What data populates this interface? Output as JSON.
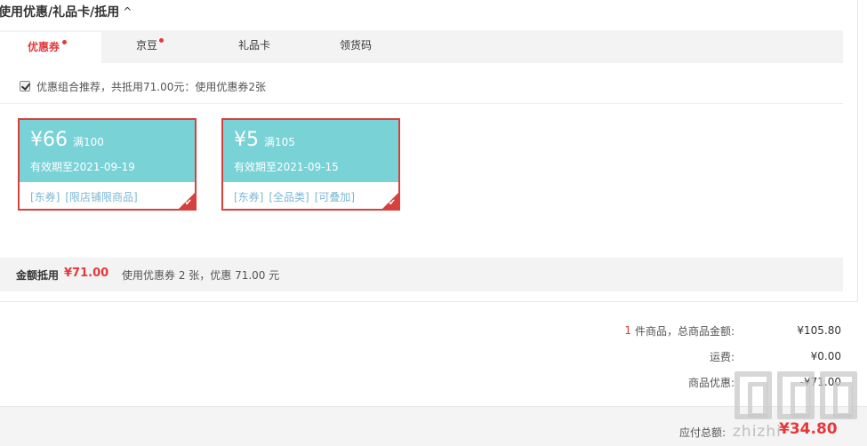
{
  "section": {
    "title": "使用优惠/礼品卡/抵用",
    "chevron": "^"
  },
  "tabs": [
    {
      "label": "优惠券",
      "active": true,
      "dot": true
    },
    {
      "label": "京豆",
      "active": false,
      "dot": true
    },
    {
      "label": "礼品卡",
      "active": false,
      "dot": false
    },
    {
      "label": "领货码",
      "active": false,
      "dot": false
    }
  ],
  "recommend": {
    "checked": true,
    "text": "优惠组合推荐，共抵用71.00元：使用优惠券2张"
  },
  "coupons": [
    {
      "amount": "¥66",
      "condition": "满100",
      "expiry": "有效期至2021-09-19",
      "tags": [
        "[东券]",
        "[限店铺限商品]"
      ],
      "selected": true
    },
    {
      "amount": "¥5",
      "condition": "满105",
      "expiry": "有效期至2021-09-15",
      "tags": [
        "[东券]",
        "[全品类]",
        "[可叠加]"
      ],
      "selected": true
    }
  ],
  "summary": {
    "label": "金额抵用",
    "amount": "¥71.00",
    "description": "使用优惠券 2 张，优惠 71.00 元"
  },
  "totals": {
    "items": {
      "count": "1",
      "label": "件商品，总商品金额:",
      "value": "¥105.80"
    },
    "shipping": {
      "label": "运费:",
      "value": "¥0.00"
    },
    "discount": {
      "label": "商品优惠:",
      "value": "-¥71.00"
    }
  },
  "pay": {
    "label": "应付总额:",
    "value": "¥34.80"
  },
  "watermark": {
    "text": "zhizhi"
  },
  "colors": {
    "accent": "#e4393c",
    "coupon_bg": "#79d2d5",
    "coupon_border": "#d6403f",
    "tag": "#79b7d5"
  },
  "icons": {
    "chevron": "chevron-up-icon",
    "check": "check-icon"
  }
}
